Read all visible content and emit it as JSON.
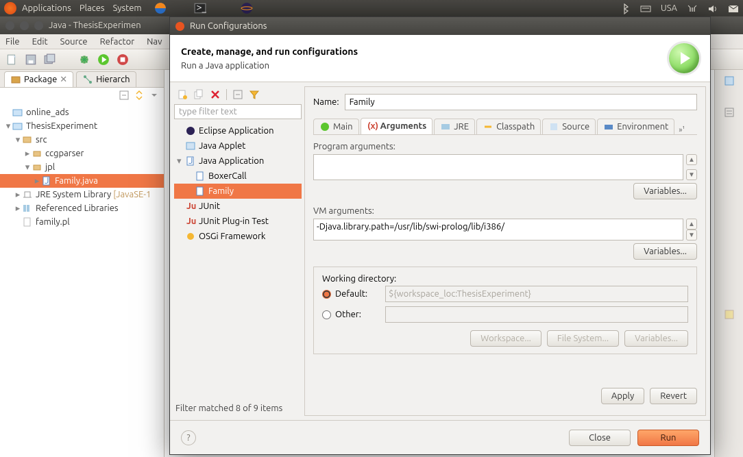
{
  "menubar": {
    "items": [
      "Applications",
      "Places",
      "System"
    ],
    "locale": "USA"
  },
  "eclipse": {
    "title": "Java - ThesisExperimen",
    "menu": [
      "File",
      "Edit",
      "Source",
      "Refactor",
      "Nav"
    ],
    "tabs": {
      "package": "Package",
      "hierarchy": "Hierarch"
    },
    "tree": {
      "online_ads": "online_ads",
      "project": "ThesisExperiment",
      "src": "src",
      "ccgparser": "ccgparser",
      "jpl": "jpl",
      "family_java": "Family.java",
      "jre": "JRE System Library",
      "jre_suffix": "[JavaSE-1",
      "reflib": "Referenced Libraries",
      "family_pl": "family.pl"
    }
  },
  "dialog": {
    "title": "Run Configurations",
    "heading": "Create, manage, and run configurations",
    "subheading": "Run a Java application",
    "filter_placeholder": "type filter text",
    "configs": {
      "eclipse_app": "Eclipse Application",
      "java_applet": "Java Applet",
      "java_app": "Java Application",
      "boxercall": "BoxerCall",
      "family": "Family",
      "junit": "JUnit",
      "junit_plugin": "JUnit Plug-in Test",
      "osgi": "OSGi Framework"
    },
    "filter_status": "Filter matched 8 of 9 items",
    "name_label": "Name:",
    "name_value": "Family",
    "tabs": {
      "main": "Main",
      "args": "Arguments",
      "jre": "JRE",
      "classpath": "Classpath",
      "source": "Source",
      "env": "Environment"
    },
    "prog_args_label": "Program arguments:",
    "prog_args_value": "",
    "vm_args_label": "VM arguments:",
    "vm_args_value": "-Djava.library.path=/usr/lib/swi-prolog/lib/i386/",
    "variables_btn": "Variables...",
    "workdir_label": "Working directory:",
    "default_label": "Default:",
    "default_value": "${workspace_loc:ThesisExperiment}",
    "other_label": "Other:",
    "workspace_btn": "Workspace...",
    "filesystem_btn": "File System...",
    "apply_btn": "Apply",
    "revert_btn": "Revert",
    "close_btn": "Close",
    "run_btn": "Run"
  }
}
